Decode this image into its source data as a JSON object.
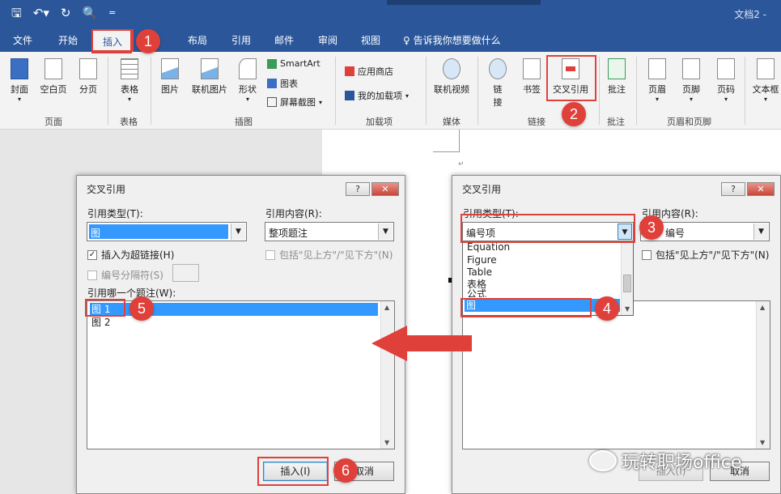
{
  "title_bar": {
    "doc_title": "文档2 -",
    "qat_icons": [
      "save-icon",
      "undo-icon",
      "redo-icon",
      "print-preview-icon",
      "customize-qat-icon"
    ],
    "qat_glyphs": [
      "🖫",
      "↶▾",
      "↻",
      "🔍",
      "="
    ]
  },
  "tabs": [
    {
      "label": "文件"
    },
    {
      "label": "开始"
    },
    {
      "label": "插入"
    },
    {
      "label": "布局"
    },
    {
      "label": "引用"
    },
    {
      "label": "邮件"
    },
    {
      "label": "审阅"
    },
    {
      "label": "视图"
    }
  ],
  "tell_me": "告诉我你想要做什么",
  "ribbon": {
    "buttons": {
      "cover": "封面",
      "blank_page": "空白页",
      "page_break": "分页",
      "table": "表格",
      "picture": "图片",
      "online_picture": "联机图片",
      "shapes": "形状",
      "online_video": "联机视频",
      "link_top": "链",
      "link_bottom": "接",
      "bookmark": "书签",
      "cross_ref": "交叉引用",
      "comment": "批注",
      "header": "页眉",
      "footer": "页脚",
      "page_number": "页码",
      "text_box": "文本框"
    },
    "small": {
      "smartart": "SmartArt",
      "chart": "图表",
      "screenshot": "屏幕截图",
      "store": "应用商店",
      "my_addins": "我的加载项"
    },
    "groups": {
      "pages": "页面",
      "tables": "表格",
      "illustrations": "插图",
      "addins": "加载项",
      "media": "媒体",
      "links": "链接",
      "comments": "批注",
      "header_footer": "页眉和页脚"
    }
  },
  "document": {
    "paragraph_mark": "↵"
  },
  "dialog_left": {
    "title": "交叉引用",
    "help_label": "?",
    "close_label": "✕",
    "ref_type_label": "引用类型(T):",
    "ref_type_value": "图",
    "ref_content_label": "引用内容(R):",
    "ref_content_value": "整项题注",
    "insert_hyperlink_label": "插入为超链接(H)",
    "insert_hyperlink_mark": "✓",
    "include_above_below_label": "包括\"见上方\"/\"见下方\"(N)",
    "separate_numbers_label": "编号分隔符(S)",
    "which_caption_label": "引用哪一个题注(W):",
    "captions": [
      "图 1",
      "图 2"
    ],
    "insert_button": "插入(I)",
    "cancel_button": "取消"
  },
  "dialog_right": {
    "title": "交叉引用",
    "help_label": "?",
    "close_label": "✕",
    "ref_type_label": "引用类型(T):",
    "ref_type_value": "编号项",
    "ref_content_label": "引用内容(R):",
    "ref_content_value": "编号",
    "include_above_below_label": "包括\"见上方\"/\"见下方\"(N)",
    "dropdown_options": [
      "Equation",
      "Figure",
      "Table",
      "表格",
      "公式",
      "图"
    ],
    "insert_button": "插入(I)",
    "cancel_button": "取消"
  },
  "steps": [
    "1",
    "2",
    "3",
    "4",
    "5",
    "6"
  ],
  "watermark": "玩转职场office",
  "colors": {
    "word_blue": "#2b579a",
    "annotation_red": "#e0403a",
    "selection_blue": "#3399ff"
  }
}
